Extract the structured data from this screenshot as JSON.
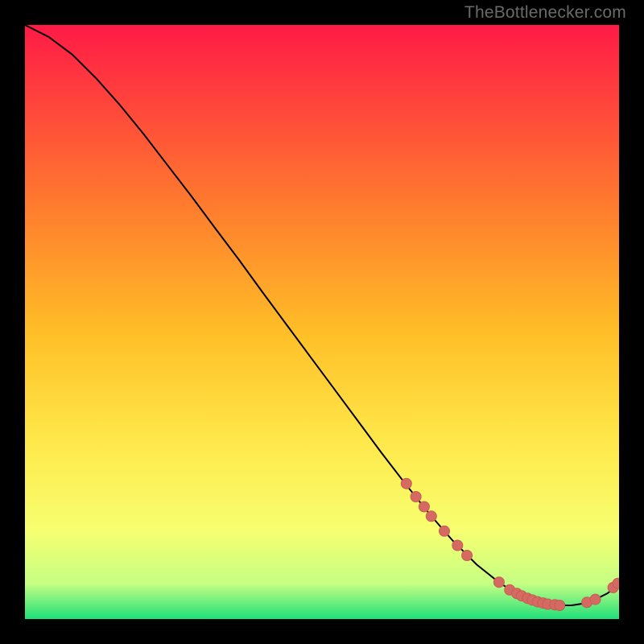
{
  "watermark": "TheBottlenecker.com",
  "colors": {
    "gradient_top": "#ff1a46",
    "gradient_mid1": "#ff6a2e",
    "gradient_mid2": "#ffbf27",
    "gradient_mid3": "#ffe84a",
    "gradient_mid4": "#f7ff70",
    "gradient_mid5": "#c6ff83",
    "gradient_bottom": "#1fe07a",
    "curve": "#000000",
    "marker_fill": "#d46a61",
    "marker_stroke": "#c75c54",
    "background": "#000000"
  },
  "chart_data": {
    "type": "line",
    "title": "",
    "xlabel": "",
    "ylabel": "",
    "xlim": [
      0,
      100
    ],
    "ylim": [
      0,
      100
    ],
    "series": [
      {
        "name": "bottleneck-curve",
        "x": [
          0,
          4,
          8,
          12,
          16,
          20,
          24,
          28,
          32,
          36,
          40,
          44,
          48,
          52,
          56,
          60,
          64,
          68,
          72,
          76,
          80,
          82,
          84,
          86,
          88,
          90,
          92,
          94,
          96,
          98,
          100
        ],
        "y": [
          100,
          98.0,
          95.0,
          91.0,
          86.5,
          81.6,
          76.4,
          71.2,
          65.8,
          60.5,
          55.0,
          49.6,
          44.2,
          38.8,
          33.4,
          28.0,
          22.8,
          17.8,
          13.2,
          9.2,
          6.0,
          4.8,
          3.8,
          3.0,
          2.5,
          2.3,
          2.3,
          2.6,
          3.3,
          4.3,
          5.8
        ]
      }
    ],
    "markers": [
      {
        "name": "cluster-descending",
        "points": [
          {
            "x": 64.2,
            "y": 22.8
          },
          {
            "x": 65.8,
            "y": 20.6
          },
          {
            "x": 67.2,
            "y": 18.9
          },
          {
            "x": 68.4,
            "y": 17.3
          },
          {
            "x": 70.6,
            "y": 14.8
          },
          {
            "x": 72.8,
            "y": 12.4
          },
          {
            "x": 74.4,
            "y": 10.7
          }
        ]
      },
      {
        "name": "cluster-valley",
        "points": [
          {
            "x": 79.8,
            "y": 6.2
          },
          {
            "x": 81.6,
            "y": 4.9
          },
          {
            "x": 82.8,
            "y": 4.3
          },
          {
            "x": 83.6,
            "y": 3.9
          },
          {
            "x": 84.6,
            "y": 3.5
          },
          {
            "x": 85.4,
            "y": 3.2
          },
          {
            "x": 86.3,
            "y": 2.9
          },
          {
            "x": 87.2,
            "y": 2.7
          },
          {
            "x": 88.0,
            "y": 2.5
          },
          {
            "x": 89.2,
            "y": 2.4
          },
          {
            "x": 90.0,
            "y": 2.3
          }
        ]
      },
      {
        "name": "cluster-rising",
        "points": [
          {
            "x": 94.6,
            "y": 2.8
          },
          {
            "x": 96.0,
            "y": 3.3
          },
          {
            "x": 99.0,
            "y": 5.3
          },
          {
            "x": 99.8,
            "y": 6.0
          }
        ]
      }
    ]
  }
}
